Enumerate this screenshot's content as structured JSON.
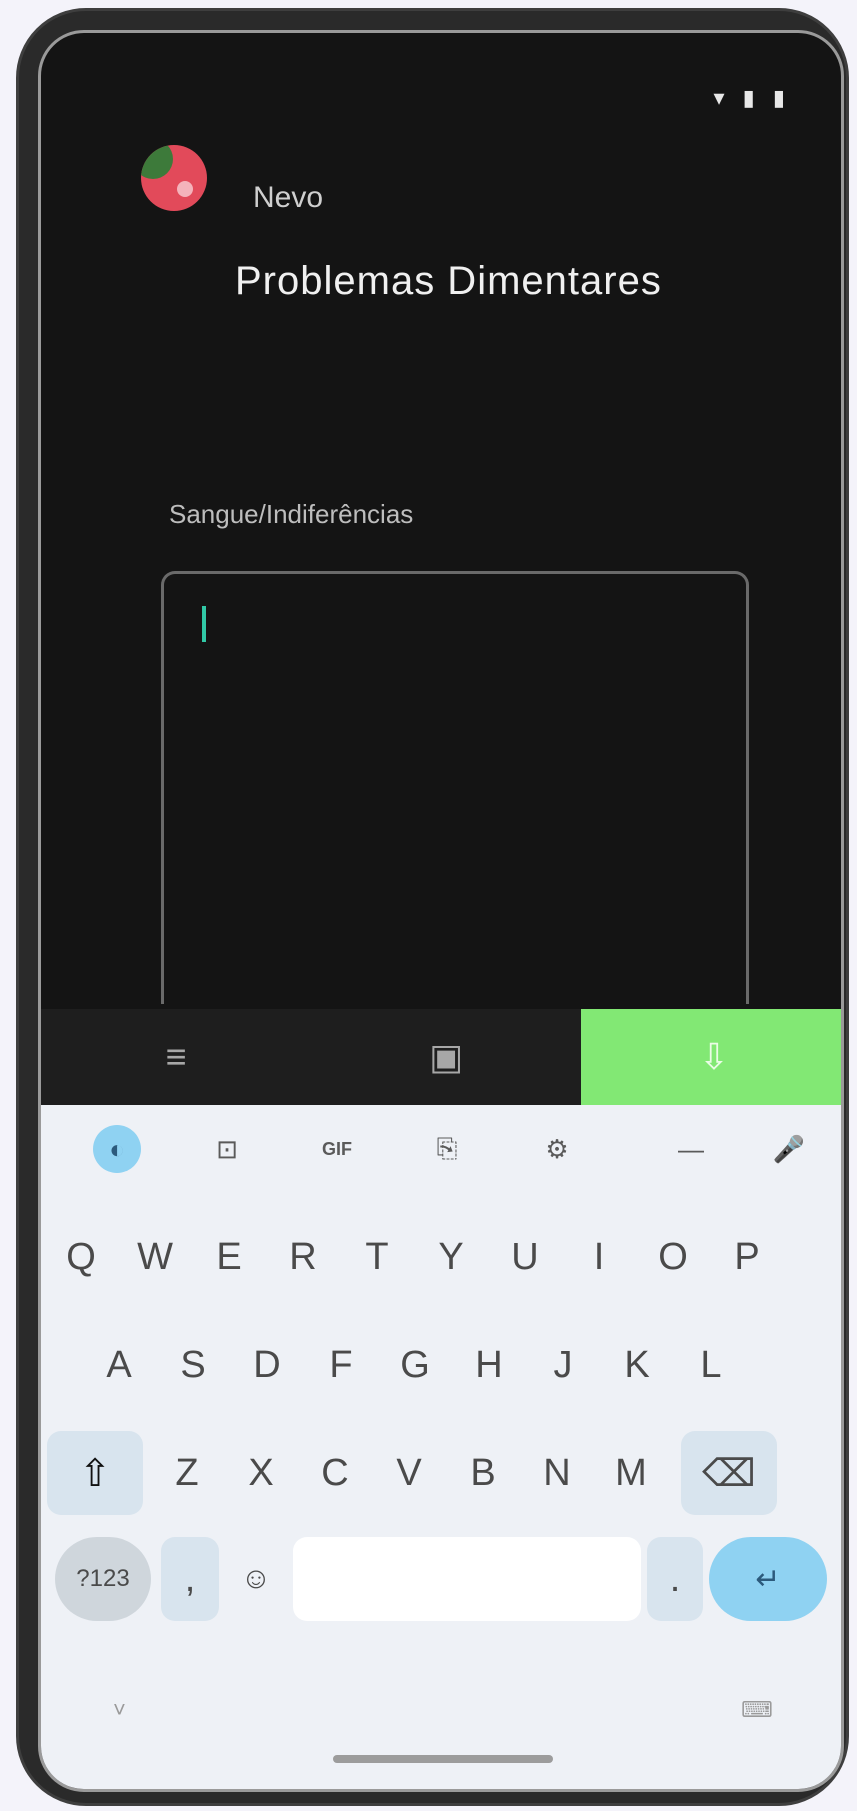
{
  "status_bar": {
    "icons": [
      "signal-icon",
      "wifi-icon",
      "battery-icon"
    ]
  },
  "app": {
    "name": "Nevo",
    "title": "Problemas Dimentares"
  },
  "form": {
    "label": "Sangue/Indiferências",
    "value": ""
  },
  "toolbar": {
    "items": [
      "≡",
      "▣",
      "⇩"
    ]
  },
  "keyboard": {
    "suggestion_icons": [
      "◐",
      "⊡",
      "GIF",
      "⎘",
      "⚙",
      "—",
      "🎤"
    ],
    "row1": [
      "Q",
      "W",
      "E",
      "R",
      "T",
      "Y",
      "U",
      "I",
      "O",
      "P"
    ],
    "row2": [
      "A",
      "S",
      "D",
      "F",
      "G",
      "H",
      "J",
      "K",
      "L"
    ],
    "row3": [
      "Z",
      "X",
      "C",
      "V",
      "B",
      "N",
      "M"
    ],
    "shift_label": "⇧",
    "backspace_label": "⌫",
    "symbols_label": "?123",
    "comma_label": ",",
    "emoji_label": "☺",
    "period_label": ".",
    "enter_label": "↵",
    "nav_left": "˅",
    "nav_right": "⌨"
  }
}
